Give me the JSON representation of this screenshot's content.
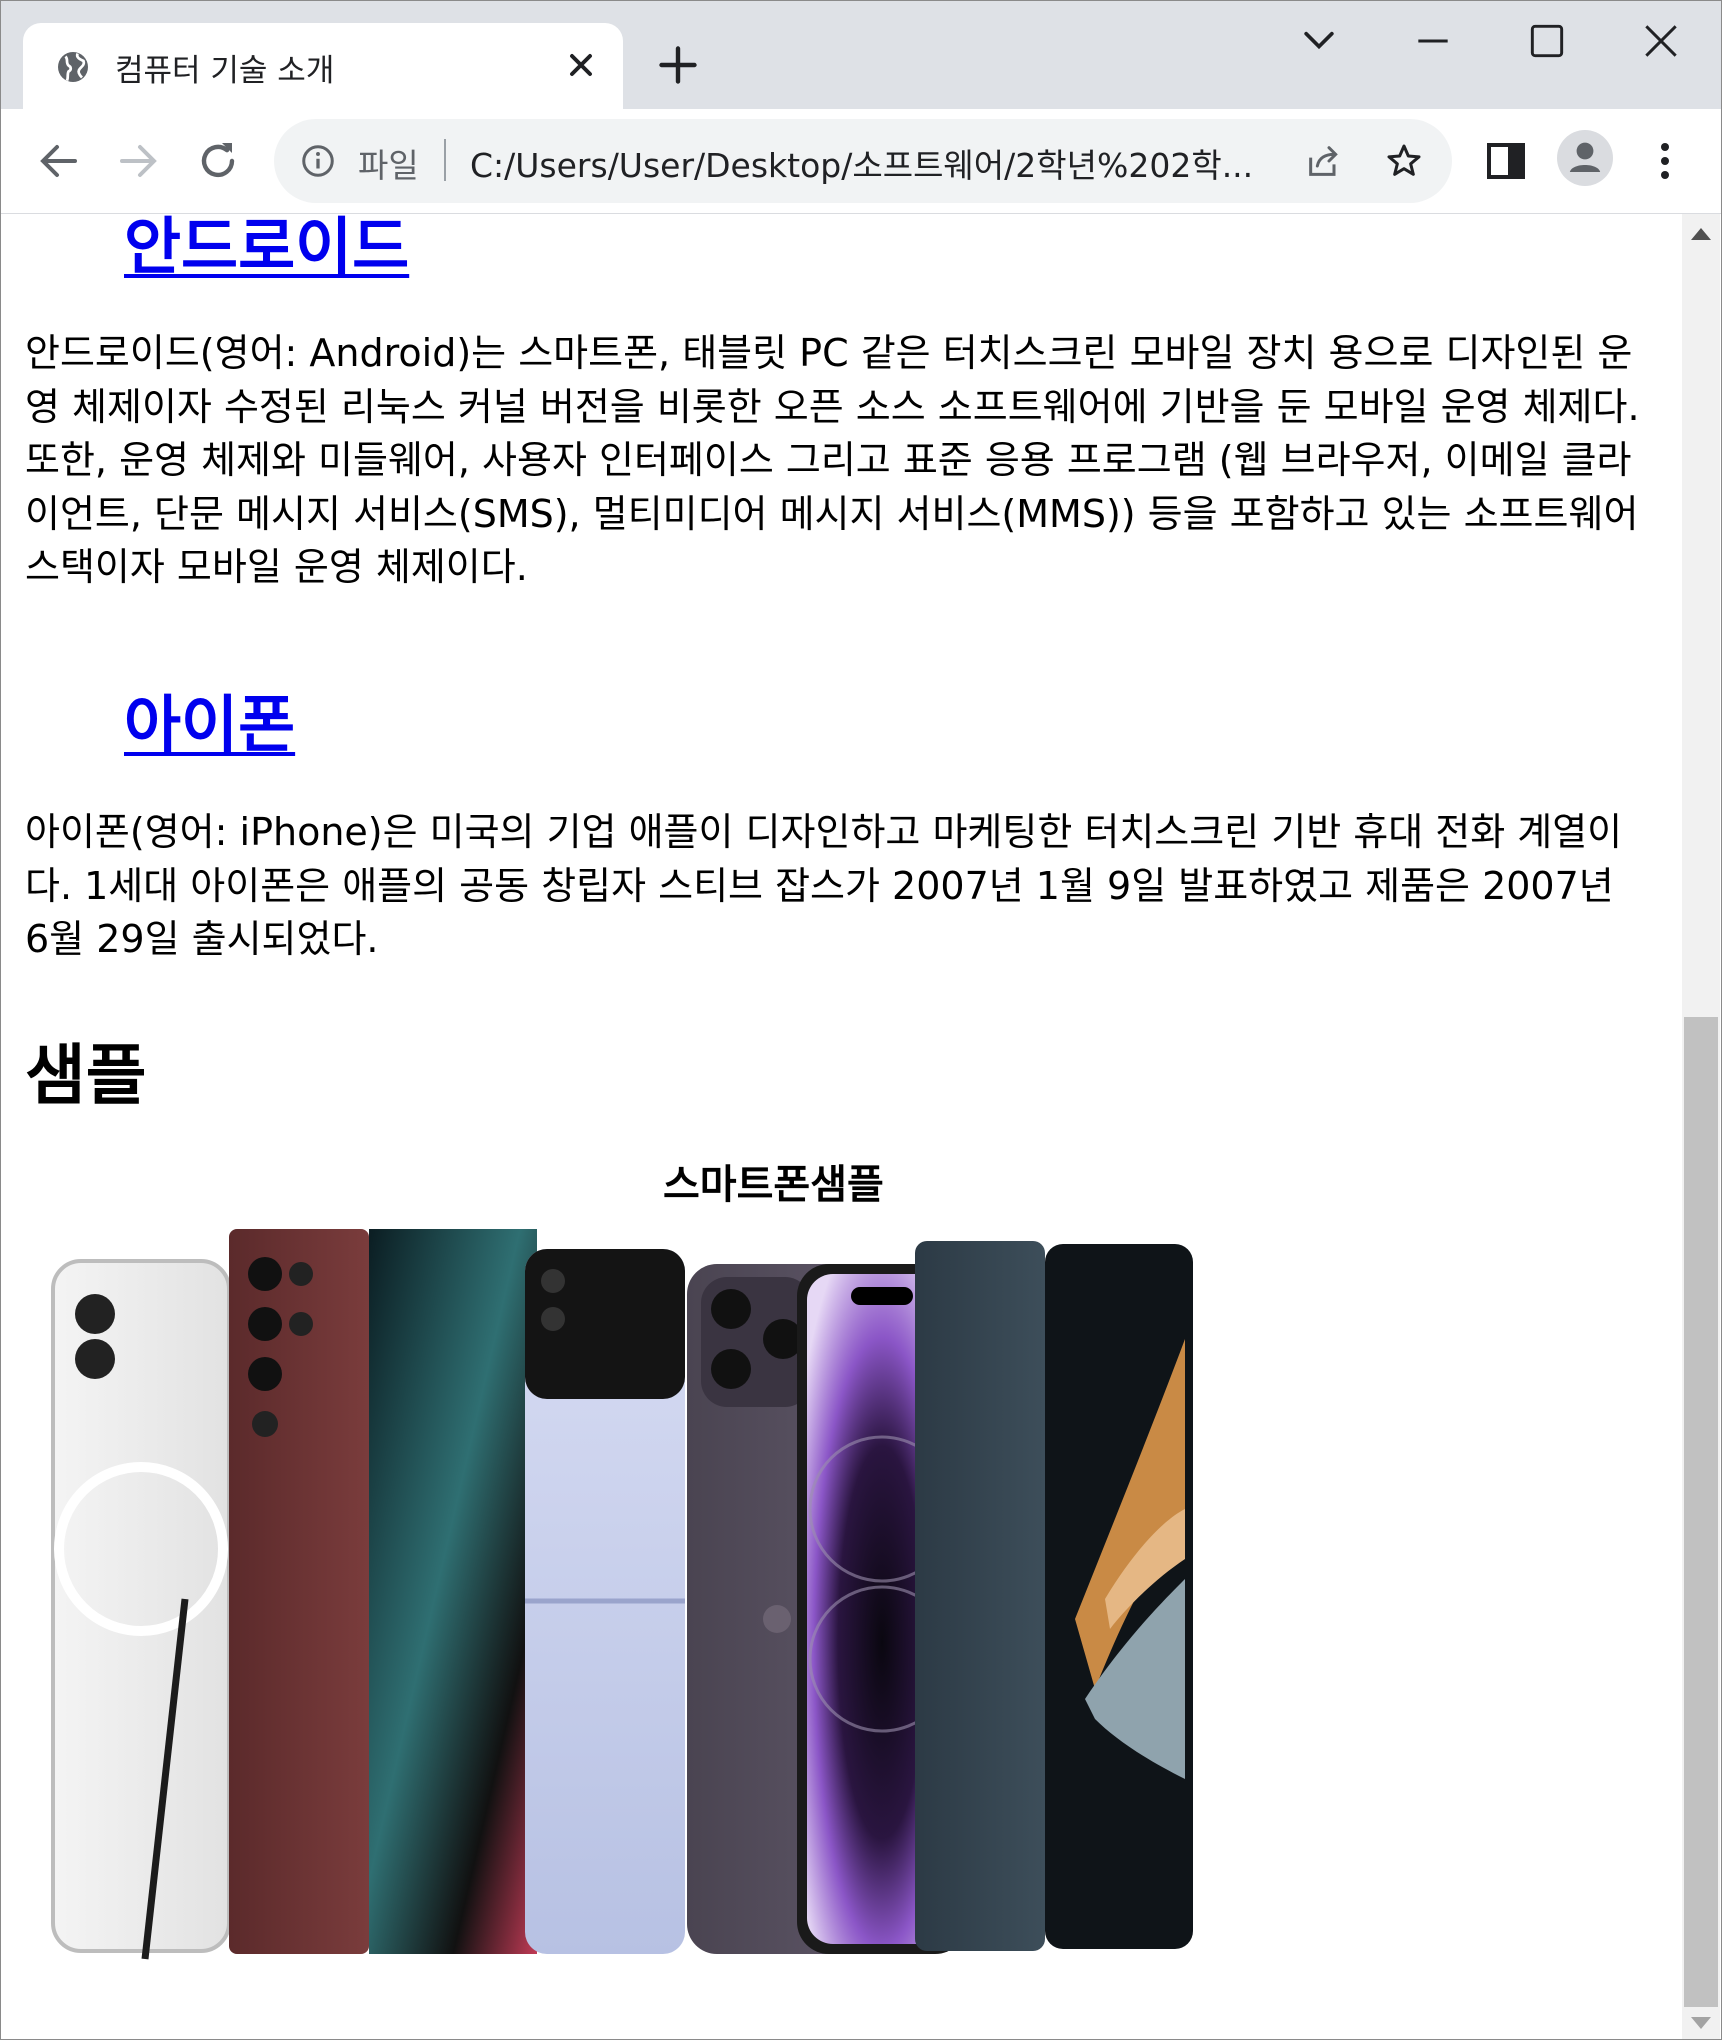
{
  "browser": {
    "tab": {
      "title": "컴퓨터 기술 소개"
    },
    "address": {
      "scheme": "파일",
      "url": "C:/Users/User/Desktop/소프트웨어/2학년%202학..."
    }
  },
  "page": {
    "sections": [
      {
        "heading": "안드로이드",
        "text": "안드로이드(영어: Android)는 스마트폰, 태블릿 PC 같은 터치스크린 모바일 장치 용으로 디자인된 운영 체제이자 수정된 리눅스 커널 버전을 비롯한 오픈 소스 소프트웨어에 기반을 둔 모바일 운영 체제다. 또한, 운영 체제와 미들웨어, 사용자 인터페이스 그리고 표준 응용 프로그램 (웹 브라우저, 이메일 클라이언트, 단문 메시지 서비스(SMS), 멀티미디어 메시지 서비스(MMS)) 등을 포함하고 있는 소프트웨어 스택이자 모바일 운영 체제이다."
      },
      {
        "heading": "아이폰",
        "text": "아이폰(영어: iPhone)은 미국의 기업 애플이 디자인하고 마케팅한 터치스크린 기반 휴대 전화 계열이다. 1세대 아이폰은 애플의 공동 창립자 스티브 잡스가 2007년 1월 9일 발표하였고 제품은 2007년 6월 29일 출시되었다."
      }
    ],
    "sample": {
      "heading": "샘플",
      "caption": "스마트폰샘플"
    }
  },
  "icons": {
    "favicon": "globe-icon",
    "tab_close": "close-icon",
    "new_tab": "plus-icon",
    "tab_search": "chevron-down-icon",
    "minimize": "minimize-icon",
    "maximize": "maximize-icon",
    "close_window": "close-window-icon",
    "back": "back-arrow-icon",
    "forward": "forward-arrow-icon",
    "reload": "reload-icon",
    "site_info": "info-icon",
    "share": "share-icon",
    "bookmark": "star-icon",
    "side_panel": "side-panel-icon",
    "profile": "profile-icon",
    "menu": "kebab-menu-icon"
  },
  "colors": {
    "link": "#0000ee",
    "tabstrip_bg": "#dee1e6",
    "omnibox_bg": "#f1f3f4",
    "scrollbar_thumb": "#c1c1c1"
  }
}
